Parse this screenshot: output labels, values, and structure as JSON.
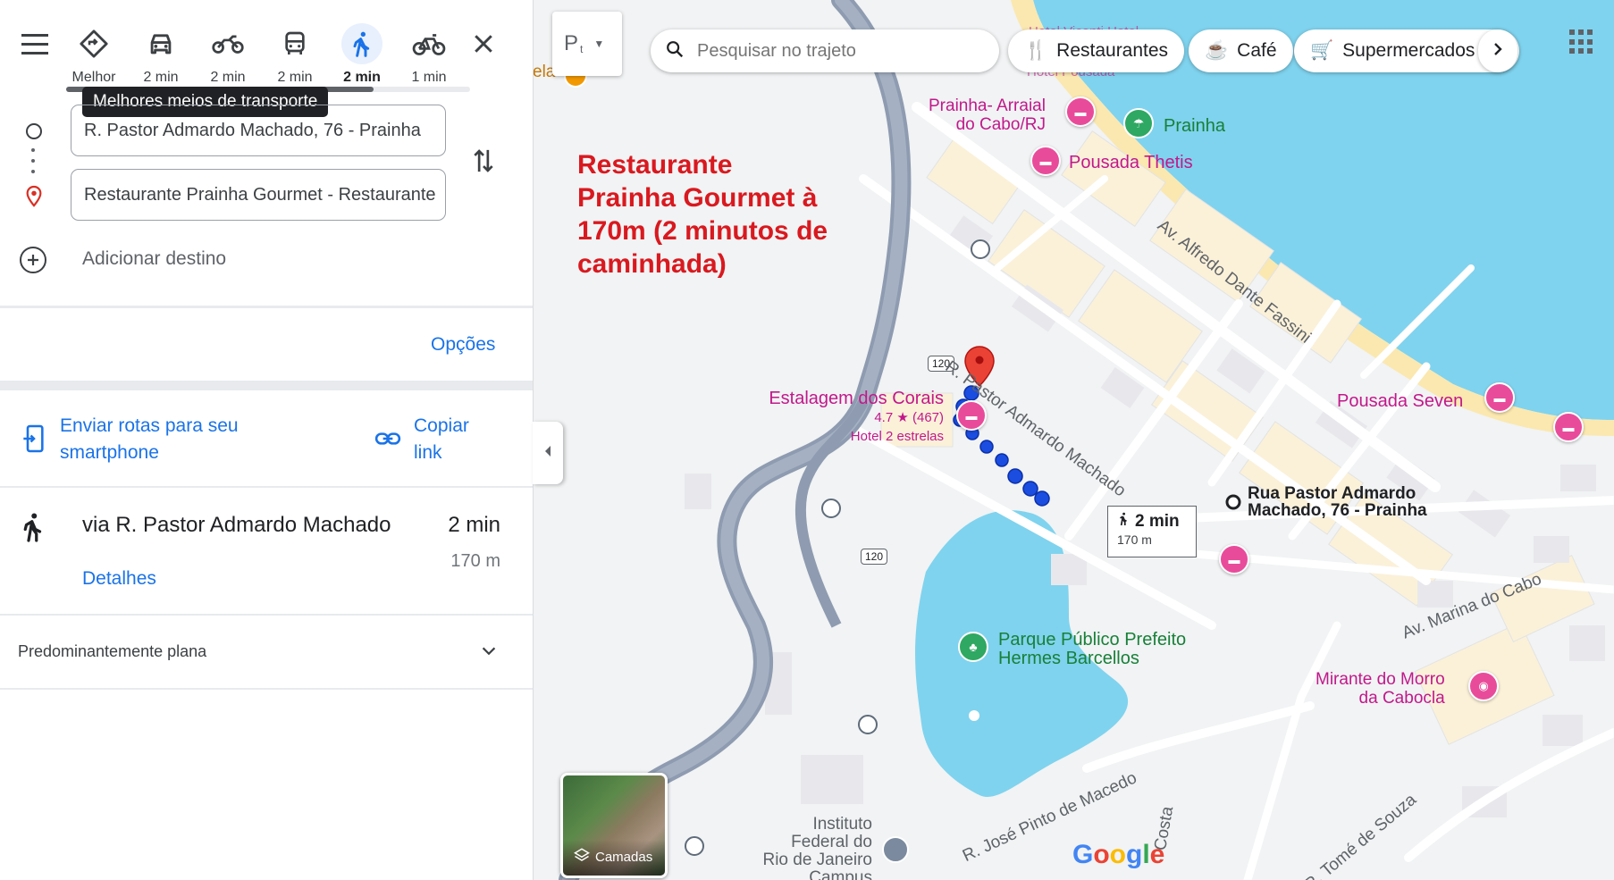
{
  "travel_modes": [
    {
      "name": "best",
      "label": "Melhor"
    },
    {
      "name": "car",
      "label": "2 min"
    },
    {
      "name": "motorcycle",
      "label": "2 min"
    },
    {
      "name": "transit",
      "label": "2 min"
    },
    {
      "name": "walk",
      "label": "2 min",
      "active": true
    },
    {
      "name": "bicycle",
      "label": "1 min"
    }
  ],
  "tooltip": "Melhores meios de transporte",
  "origin": {
    "value": "R. Pastor Admardo Machado, 76 - Prainha"
  },
  "destination": {
    "value": "Restaurante Prainha Gourmet - Restaurante"
  },
  "add_destination": "Adicionar destino",
  "options_label": "Opções",
  "send_to_phone": {
    "line1": "Enviar rotas para seu",
    "line2": "smartphone"
  },
  "copy_link": {
    "line1": "Copiar",
    "line2": "link"
  },
  "route": {
    "via": "via R. Pastor Admardo Machado",
    "duration": "2 min",
    "distance": "170 m",
    "details": "Detalhes"
  },
  "terrain": "Predominantemente plana",
  "map": {
    "search_placeholder": "Pesquisar no trajeto",
    "parking_label": "P",
    "chips": [
      "Restaurantes",
      "Café",
      "Supermercados"
    ],
    "annotation": [
      "Restaurante",
      "Prainha Gourmet à",
      "170m (2 minutos de",
      "caminhada)"
    ],
    "labels": {
      "prainha_arraial": [
        "Prainha- Arraial",
        "do Cabo/RJ"
      ],
      "prainha": "Prainha",
      "pousada_thetis": "Pousada Thetis",
      "estalagem": "Estalagem dos Corais",
      "estalagem_rating": "4.7 ★ (467)",
      "estalagem_type": "Hotel 2 estrelas",
      "pousada_seven": "Pousada Seven",
      "origin_label": [
        "Rua Pastor Admardo",
        "Machado, 76 - Prainha"
      ],
      "parque": [
        "Parque Público Prefeito",
        "Hermes Barcellos"
      ],
      "mirante": [
        "Mirante do Morro",
        "da Cabocla"
      ],
      "instituto": [
        "Instituto",
        "Federal do",
        "Rio de Janeiro",
        "Campus"
      ],
      "street_pastor": "R. Pastor Admardo Machado",
      "street_alfredo": "Av. Alfredo Dante Fassini",
      "street_marina": "Av. Marina do Cabo",
      "street_jose": "R. José Pinto de Macedo",
      "street_tome": "R. Tomé de Souza",
      "street_costa": "Costa",
      "road_120": "120",
      "ela": "ela",
      "top_hotel": "Hotel Vicenti Hotel",
      "top_hotel2": "Hotel Pousada"
    },
    "route_box": {
      "time": "2 min",
      "dist": "170 m"
    },
    "layers_label": "Camadas",
    "google": [
      "G",
      "o",
      "o",
      "g",
      "l",
      "e"
    ],
    "google_colors": [
      "#4285f4",
      "#ea4335",
      "#fbbc05",
      "#4285f4",
      "#34a853",
      "#ea4335"
    ]
  }
}
